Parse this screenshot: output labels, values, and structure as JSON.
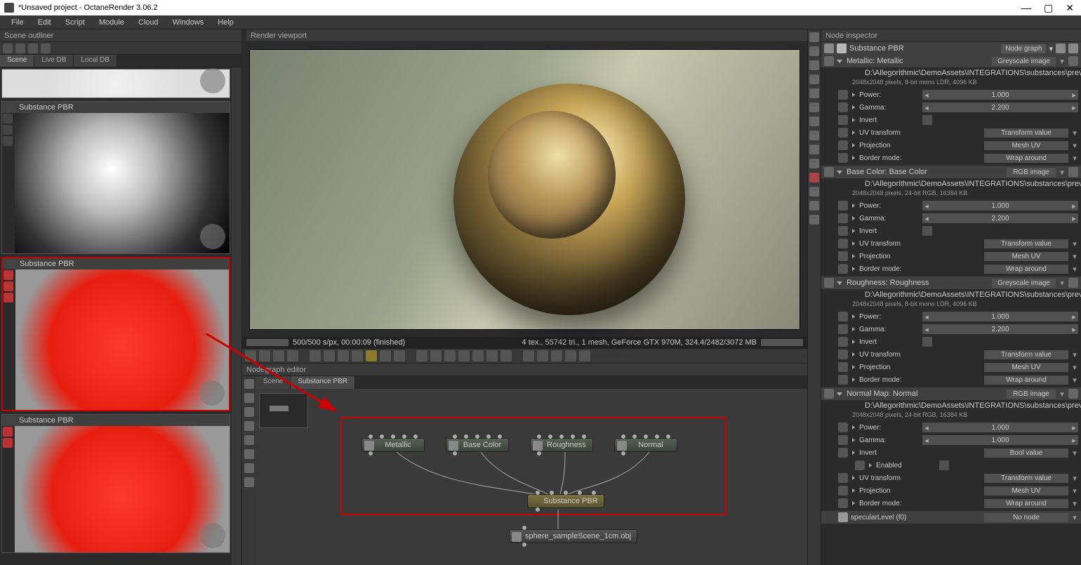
{
  "window": {
    "title": "*Unsaved project - OctaneRender 3.06.2"
  },
  "menu": [
    "File",
    "Edit",
    "Script",
    "Module",
    "Cloud",
    "Windows",
    "Help"
  ],
  "outliner": {
    "title": "Scene outliner",
    "tabs": [
      "Scene",
      "Live DB",
      "Local DB"
    ],
    "materials": [
      {
        "name": ""
      },
      {
        "name": "Substance PBR"
      },
      {
        "name": "Substance PBR",
        "selected": true
      },
      {
        "name": "Substance PBR"
      }
    ]
  },
  "viewport": {
    "title": "Render viewport",
    "status_left": "500/500 s/px, 00:00:09 (finished)",
    "status_right": "4 tex., 55742 tri., 1 mesh, GeForce GTX 970M, 324.4/2482/3072 MB"
  },
  "nodegraph": {
    "title": "Nodegraph editor",
    "tabs": [
      "Scene",
      "Substance PBR"
    ],
    "nodes": {
      "metallic": "Metallic",
      "base": "Base Color",
      "rough": "Roughness",
      "normal": "Normal",
      "pbr": "Substance PBR",
      "mesh": "sphere_sampleScene_1cm.obj"
    }
  },
  "inspector": {
    "title": "Node inspector",
    "material": "Substance PBR",
    "mode": "Node graph",
    "sections": [
      {
        "name": "Metallic: Metallic",
        "type": "Greyscale image",
        "path": "D:\\Allegorithmic\\DemoAssets\\INTEGRATIONS\\substances\\preview_sphere_exports\\Sphere_Metallic.png",
        "meta": "2048x2048 pixels, 8-bit mono LDR, 4096 KB",
        "props": [
          {
            "k": "Power:",
            "v": "1.000",
            "t": "slider"
          },
          {
            "k": "Gamma:",
            "v": "2.200",
            "t": "slider"
          },
          {
            "k": "Invert",
            "t": "check"
          },
          {
            "k": "UV transform",
            "v": "Transform value",
            "t": "dd"
          },
          {
            "k": "Projection",
            "v": "Mesh UV",
            "t": "dd"
          },
          {
            "k": "Border mode:",
            "v": "Wrap around",
            "t": "dd"
          }
        ]
      },
      {
        "name": "Base Color: Base Color",
        "type": "RGB image",
        "path": "D:\\Allegorithmic\\DemoAssets\\INTEGRATIONS\\substances\\preview_sphere_exports\\Sphere_Base_Color...",
        "meta": "2048x2048 pixels, 24-bit RGB, 16384 KB",
        "props": [
          {
            "k": "Power:",
            "v": "1.000",
            "t": "slider"
          },
          {
            "k": "Gamma:",
            "v": "2.200",
            "t": "slider"
          },
          {
            "k": "Invert",
            "t": "check"
          },
          {
            "k": "UV transform",
            "v": "Transform value",
            "t": "dd"
          },
          {
            "k": "Projection",
            "v": "Mesh UV",
            "t": "dd"
          },
          {
            "k": "Border mode:",
            "v": "Wrap around",
            "t": "dd"
          }
        ]
      },
      {
        "name": "Roughness: Roughness",
        "type": "Greyscale image",
        "path": "D:\\Allegorithmic\\DemoAssets\\INTEGRATIONS\\substances\\preview_sphere_exports\\renderman_prnSur...",
        "meta": "2048x2048 pixels, 8-bit mono LDR, 4096 KB",
        "props": [
          {
            "k": "Power:",
            "v": "1.000",
            "t": "slider"
          },
          {
            "k": "Gamma:",
            "v": "2.200",
            "t": "slider"
          },
          {
            "k": "Invert",
            "t": "check"
          },
          {
            "k": "UV transform",
            "v": "Transform value",
            "t": "dd"
          },
          {
            "k": "Projection",
            "v": "Mesh UV",
            "t": "dd"
          },
          {
            "k": "Border mode:",
            "v": "Wrap around",
            "t": "dd"
          }
        ]
      },
      {
        "name": "Normal Map: Normal",
        "type": "RGB image",
        "path": "D:\\Allegorithmic\\DemoAssets\\INTEGRATIONS\\substances\\preview_sphere_exports\\renderman_prnSur...",
        "meta": "2048x2048 pixels, 24-bit RGB, 16384 KB",
        "props": [
          {
            "k": "Power:",
            "v": "1.000",
            "t": "slider"
          },
          {
            "k": "Gamma:",
            "v": "1.000",
            "t": "slider"
          },
          {
            "k": "Invert",
            "v": "Bool value",
            "t": "dd_tri"
          },
          {
            "k": "Enabled",
            "t": "check",
            "indent": true
          },
          {
            "k": "UV transform",
            "v": "Transform value",
            "t": "dd"
          },
          {
            "k": "Projection",
            "v": "Mesh UV",
            "t": "dd"
          },
          {
            "k": "Border mode:",
            "v": "Wrap around",
            "t": "dd"
          }
        ]
      }
    ],
    "footer": {
      "label": "specularLevel (f0)",
      "value": "No node"
    }
  }
}
